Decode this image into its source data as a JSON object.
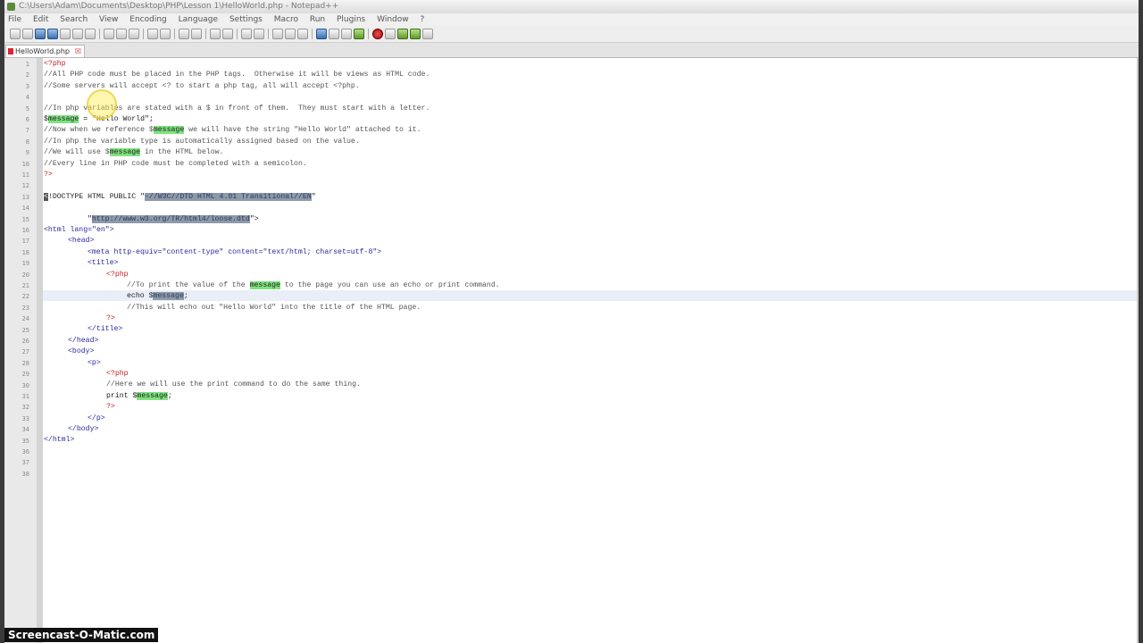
{
  "window": {
    "title": "C:\\Users\\Adam\\Documents\\Desktop\\PHP\\Lesson 1\\HelloWorld.php - Notepad++"
  },
  "menu": [
    "File",
    "Edit",
    "Search",
    "View",
    "Encoding",
    "Language",
    "Settings",
    "Macro",
    "Run",
    "Plugins",
    "Window",
    "?"
  ],
  "tab": {
    "label": "HelloWorld.php",
    "close": "☒"
  },
  "editor": {
    "line_numbers": [
      "1",
      "2",
      "3",
      "4",
      "5",
      "6",
      "7",
      "8",
      "9",
      "10",
      "11",
      "12",
      "13",
      "14",
      "15",
      "16",
      "17",
      "18",
      "19",
      "20",
      "21",
      "22",
      "23",
      "24",
      "25",
      "26",
      "27",
      "28",
      "29",
      "30",
      "31",
      "32",
      "33",
      "34",
      "35",
      "36",
      "37",
      "38"
    ],
    "lines": {
      "l1": "<?php",
      "l2": "//All PHP code must be placed in the PHP tags.  Otherwise it will be views as HTML code.",
      "l3": "//Some servers will accept <? to start a php tag, all will accept <?php.",
      "l5": "//In php variables are stated with a $ in front of them.  They must start with a letter.",
      "l6a": "$",
      "l6b": "message",
      "l6c": " = \"Hello World\";",
      "l7a": "//Now when we reference $",
      "l7b": "message",
      "l7c": " we will have the string \"Hello World\" attached to it.",
      "l8": "//In php the variable type is automatically assigned based on the value.",
      "l9a": "//We will use $",
      "l9b": "message",
      "l9c": " in the HTML below.",
      "l10": "//Every line in PHP code must be completed with a semicolon.",
      "l11": "?>",
      "l13a": "<",
      "l13b": "!DOCTYPE HTML PUBLIC \"",
      "l13c": "-//W3C//DTD HTML 4.01 Transitional//EN",
      "l13d": "\"",
      "l15a": "\"",
      "l15b": "http://www.w3.org/TR/html4/loose.dtd",
      "l15c": "\">",
      "l16": "<html lang=\"en\">",
      "l17": "<head>",
      "l18": "<meta http-equiv=\"content-type\" content=\"text/html; charset=utf-8\">",
      "l19": "<title>",
      "l20": "<?php",
      "l21a": "//To print the value of the ",
      "l21b": "message",
      "l21c": " to the page you can use an echo or print command.",
      "l22a": "echo $",
      "l22b": "message",
      "l22c": ";",
      "l23": "//This will echo out \"Hello World\" into the title of the HTML page.",
      "l24": "?>",
      "l25": "</title>",
      "l26": "</head>",
      "l27": "<body>",
      "l28": "<p>",
      "l29": "<?php",
      "l30": "//Here we will use the print command to do the same thing.",
      "l31a": "print $",
      "l31b": "message",
      "l31c": ";",
      "l32": "?>",
      "l33": "</p>",
      "l34": "</body>",
      "l35": "</html>"
    }
  },
  "watermark": "Screencast-O-Matic.com",
  "colors": {
    "highlight": "#7fe37f",
    "selection": "#8e9aa8",
    "php_tag": "#c41f1f"
  }
}
